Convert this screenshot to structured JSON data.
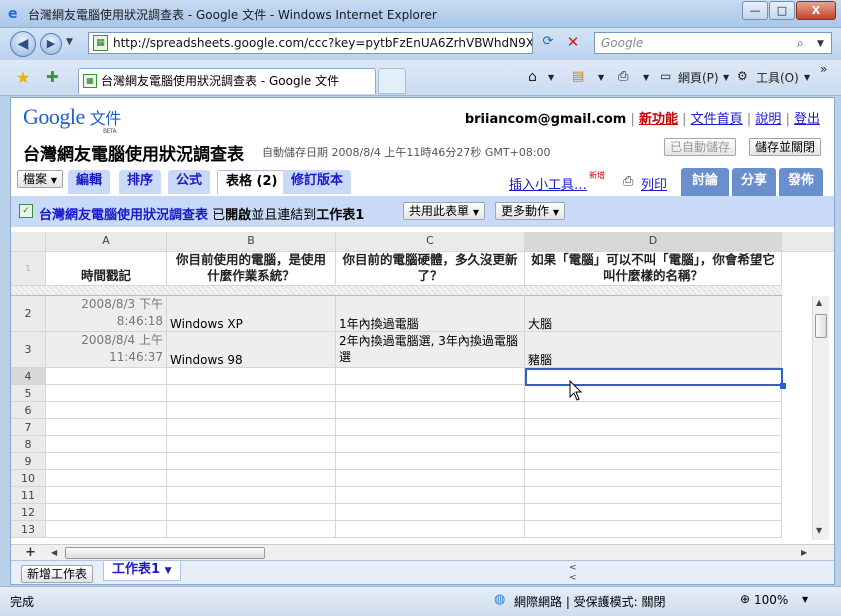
{
  "window": {
    "title": "台灣網友電腦使用狀況調查表 - Google 文件 - Windows Internet Explorer",
    "controls": {
      "minimize": "—",
      "maximize": "□",
      "close": "X"
    }
  },
  "address_bar": {
    "url": "http://spreadsheets.google.com/ccc?key=pytbFzEnUA6ZrhVBWhdN9X",
    "search_placeholder": "Google"
  },
  "browser_tab": {
    "title": "台灣網友電腦使用狀況調查表 - Google 文件"
  },
  "browser_tools": {
    "page": "網頁(P)",
    "tools": "工具(O)"
  },
  "header": {
    "logo_google": "Google",
    "logo_docs": "文件",
    "logo_beta": "BETA",
    "email": "briiancom@gmail.com",
    "links": [
      "新功能",
      "文件首頁",
      "說明",
      "登出"
    ]
  },
  "doc": {
    "title": "台灣網友電腦使用狀況調查表",
    "autosave": "自動儲存日期 2008/8/4 上午11時46分27秒 GMT+08:00",
    "autosaved_btn": "已自動儲存",
    "save_close_btn": "儲存並關閉"
  },
  "menu": {
    "file": "檔案",
    "tabs": [
      "編輯",
      "排序",
      "公式",
      "表格 (2)",
      "修訂版本"
    ],
    "insert_gadget": "插入小工具…",
    "new_badge": "新增",
    "print": "列印",
    "right_tabs": [
      "討論",
      "分享",
      "發佈"
    ]
  },
  "infobar": {
    "form_title": "台灣網友電腦使用狀況調查表",
    "opened_text": "已",
    "opened_bold": "開啟",
    "linked_text": "並且連結到",
    "sheet_bold": "工作表1",
    "share_form": "共用此表單",
    "more_actions": "更多動作"
  },
  "grid": {
    "columns": [
      "A",
      "B",
      "C",
      "D"
    ],
    "headers": [
      "時間戳記",
      "你目前使用的電腦，是使用什麼作業系統？",
      "你目前的電腦硬體，多久沒更新了？",
      "如果「電腦」可以不叫「電腦」，你會希望它叫什麼樣的名稱？"
    ],
    "header_row_num": "1",
    "rows": [
      {
        "num": "2",
        "a1": "2008/8/3 下午",
        "a2": "8:46:18",
        "b": "Windows XP",
        "c": "1年內換過電腦",
        "d": "大腦"
      },
      {
        "num": "3",
        "a1": "2008/8/4 上午",
        "a2": "11:46:37",
        "b": "Windows 98",
        "c": "2年內換過電腦選, 3年內換過電腦選",
        "d": "豬腦"
      }
    ],
    "empty_rows": [
      "4",
      "5",
      "6",
      "7",
      "8",
      "9",
      "10",
      "11",
      "12",
      "13"
    ]
  },
  "sheetbar": {
    "add_sheet": "新增工作表",
    "sheet1": "工作表1"
  },
  "statusbar": {
    "done": "完成",
    "zone": "網際網路 | 受保護模式: 關閉",
    "zoom": "100%"
  }
}
